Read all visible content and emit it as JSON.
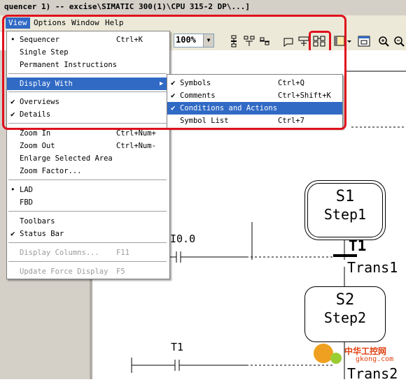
{
  "window": {
    "title": "quencer 1) -- excise\\SIMATIC 300(1)\\CPU 315-2 DP\\...]"
  },
  "menubar": [
    {
      "label": "View",
      "active": true
    },
    {
      "label": "Options"
    },
    {
      "label": "Window"
    },
    {
      "label": "Help"
    }
  ],
  "toolbar": {
    "zoom_value": "100%"
  },
  "view_menu": {
    "items": [
      {
        "label": "Sequencer",
        "shortcut": "Ctrl+K",
        "mark": "•"
      },
      {
        "label": "Single Step",
        "shortcut": ""
      },
      {
        "label": "Permanent Instructions",
        "shortcut": ""
      },
      {
        "label": "Display With",
        "shortcut": "",
        "submenu": true,
        "highlight": true
      },
      {
        "label": "Overviews",
        "shortcut": "",
        "mark": "✔"
      },
      {
        "label": "Details",
        "shortcut": "",
        "mark": "✔"
      },
      {
        "label": "Zoom In",
        "shortcut": "Ctrl+Num+"
      },
      {
        "label": "Zoom Out",
        "shortcut": "Ctrl+Num-"
      },
      {
        "label": "Enlarge Selected Area",
        "shortcut": ""
      },
      {
        "label": "Zoom Factor...",
        "shortcut": ""
      },
      {
        "label": "LAD",
        "shortcut": "",
        "mark": "•"
      },
      {
        "label": "FBD",
        "shortcut": ""
      },
      {
        "label": "Toolbars",
        "shortcut": ""
      },
      {
        "label": "Status Bar",
        "shortcut": "",
        "mark": "✔"
      },
      {
        "label": "Display Columns...",
        "shortcut": "F11",
        "disabled": true
      },
      {
        "label": "Update Force Display",
        "shortcut": "F5",
        "disabled": true
      }
    ]
  },
  "display_with_submenu": {
    "items": [
      {
        "label": "Symbols",
        "shortcut": "Ctrl+Q",
        "mark": "✔"
      },
      {
        "label": "Comments",
        "shortcut": "Ctrl+Shift+K",
        "mark": "✔"
      },
      {
        "label": "Conditions and Actions",
        "shortcut": "",
        "mark": "✔",
        "highlight": true
      },
      {
        "label": "Symbol List",
        "shortcut": "Ctrl+7"
      }
    ]
  },
  "diagram": {
    "step1": {
      "name": "S1",
      "label": "Step1"
    },
    "trans1": {
      "name": "T1",
      "label": "Trans1"
    },
    "step2": {
      "name": "S2",
      "label": "Step2"
    },
    "trans2_label": "Trans2",
    "contact1": "I0.0",
    "contact2": "T1"
  },
  "watermark": {
    "text": "中华工控网",
    "domain": "gkong.com"
  },
  "colors": {
    "highlight": "#316ac5",
    "red_frame": "#e0101c",
    "menu_bg": "#ece9d8"
  }
}
